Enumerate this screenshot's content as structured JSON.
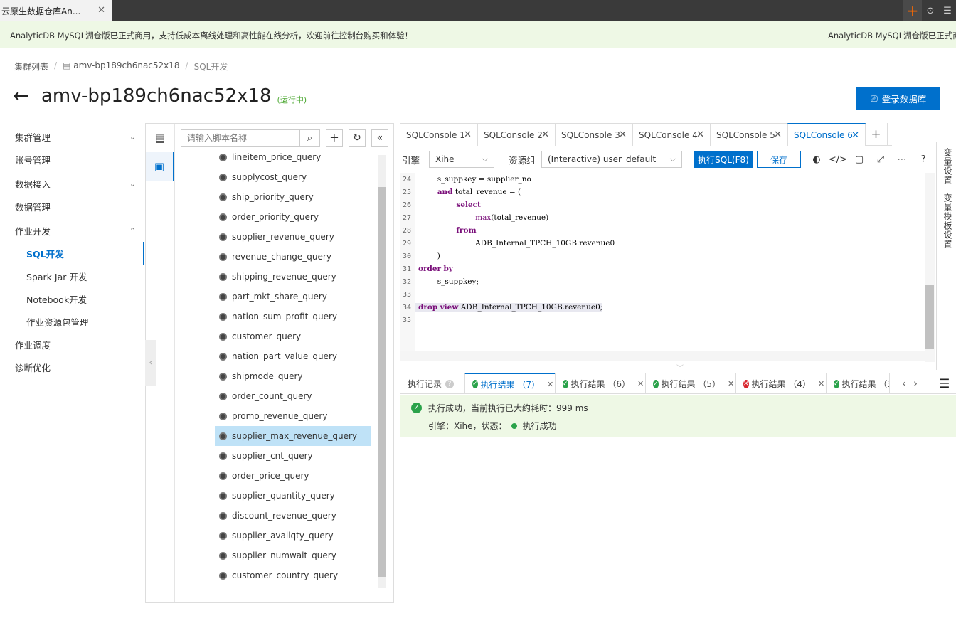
{
  "browser": {
    "tab_title": "云原生数据仓库An...",
    "close": "✕",
    "new_tab": "+"
  },
  "banner": {
    "text": "AnalyticDB MySQL湖仓版已正式商用，支持低成本离线处理和高性能在线分析，欢迎前往控制台购买和体验！",
    "text_repeat": "AnalyticDB MySQL湖仓版已正式商"
  },
  "breadcrumb": {
    "root": "集群列表",
    "cluster": "amv-bp189ch6nac52x18",
    "current": "SQL开发",
    "sep": "/"
  },
  "header": {
    "title": "amv-bp189ch6nac52x18",
    "status": "(运行中)",
    "login_button": "登录数据库"
  },
  "nav": {
    "items": [
      {
        "label": "集群管理",
        "chev": "⌄"
      },
      {
        "label": "账号管理"
      },
      {
        "label": "数据接入",
        "chev": "⌄"
      },
      {
        "label": "数据管理"
      },
      {
        "label": "作业开发",
        "chev": "⌃"
      },
      {
        "label": "SQL开发"
      },
      {
        "label": "Spark Jar 开发"
      },
      {
        "label": "Notebook开发"
      },
      {
        "label": "作业资源包管理"
      },
      {
        "label": "作业调度"
      },
      {
        "label": "诊断优化"
      }
    ]
  },
  "tree": {
    "search_placeholder": "请输入脚本名称",
    "items": [
      "lineitem_price_query",
      "supplycost_query",
      "ship_priority_query",
      "order_priority_query",
      "supplier_revenue_query",
      "revenue_change_query",
      "shipping_revenue_query",
      "part_mkt_share_query",
      "nation_sum_profit_query",
      "customer_query",
      "nation_part_value_query",
      "shipmode_query",
      "order_count_query",
      "promo_revenue_query",
      "supplier_max_revenue_query",
      "supplier_cnt_query",
      "order_price_query",
      "supplier_quantity_query",
      "discount_revenue_query",
      "supplier_availqty_query",
      "supplier_numwait_query",
      "customer_country_query"
    ]
  },
  "consoles": {
    "tabs": [
      "SQLConsole 1",
      "SQLConsole 2",
      "SQLConsole 3",
      "SQLConsole 4",
      "SQLConsole 5",
      "SQLConsole 6"
    ],
    "close": "✕",
    "add": "+"
  },
  "toolbar": {
    "engine_label": "引擎",
    "engine_value": "Xihe",
    "resource_label": "资源组",
    "resource_value": "(Interactive) user_default",
    "run_button": "执行SQL(F8)",
    "save_button": "保存"
  },
  "editor": {
    "lines": [
      {
        "n": "24",
        "code": "        s_suppkey = supplier_no"
      },
      {
        "n": "25",
        "code": "        and total_revenue = ("
      },
      {
        "n": "26",
        "code": "                select"
      },
      {
        "n": "27",
        "code": "                        max(total_revenue)"
      },
      {
        "n": "28",
        "code": "                from"
      },
      {
        "n": "29",
        "code": "                        ADB_Internal_TPCH_10GB.revenue0"
      },
      {
        "n": "30",
        "code": "        )"
      },
      {
        "n": "31",
        "code": "order by"
      },
      {
        "n": "32",
        "code": "        s_suppkey;"
      },
      {
        "n": "33",
        "code": ""
      },
      {
        "n": "34",
        "code": "drop view ADB_Internal_TPCH_10GB.revenue0;"
      },
      {
        "n": "35",
        "code": ""
      }
    ]
  },
  "right_panel": {
    "vars": "变量设置",
    "template_vars": "变量模板设置"
  },
  "results": {
    "tabs": [
      {
        "label": "执行记录",
        "kind": "history"
      },
      {
        "label": "执行结果 （7）",
        "kind": "ok"
      },
      {
        "label": "执行结果 （6）",
        "kind": "ok"
      },
      {
        "label": "执行结果 （5）",
        "kind": "ok"
      },
      {
        "label": "执行结果 （4）",
        "kind": "err"
      },
      {
        "label": "执行结果 （3",
        "kind": "ok"
      }
    ],
    "message": "执行成功，当前执行已大约耗时：999 ms",
    "engine_status_prefix": "引擎：Xihe，状态：",
    "status_text": "执行成功"
  }
}
